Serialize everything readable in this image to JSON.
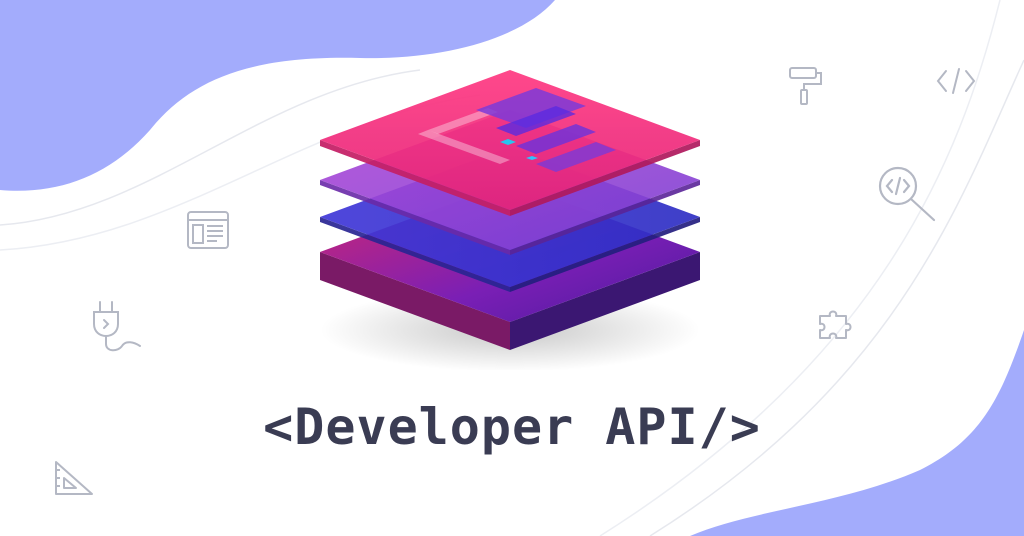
{
  "banner": {
    "title": "<Developer API/>"
  },
  "colors": {
    "background_blob": "#a3acfc",
    "title_text": "#3a3c53",
    "icon_stroke": "#b4b8c4",
    "layer_top": "#ff3a7c",
    "layer_second": "#9b3fd6",
    "layer_third": "#3f39d6",
    "layer_bottom": "#d1296f"
  },
  "icons": [
    "paint-roller-icon",
    "code-brackets-icon",
    "code-search-icon",
    "browser-layout-icon",
    "plug-icon",
    "puzzle-piece-icon",
    "set-square-icon",
    "layered-logo-icon"
  ]
}
